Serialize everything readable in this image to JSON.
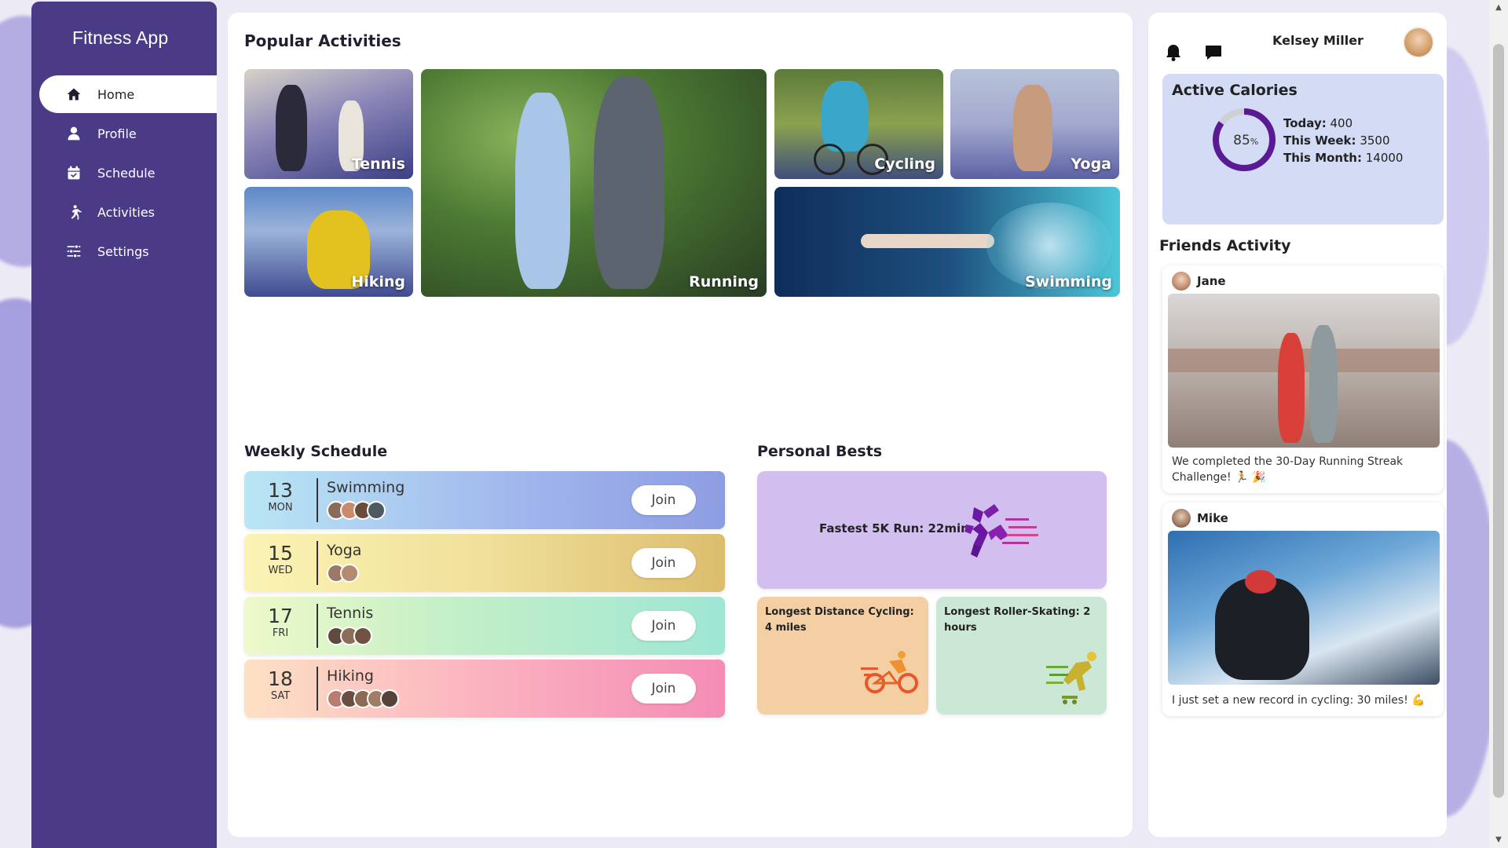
{
  "app": {
    "title": "Fitness App"
  },
  "sidebar": {
    "items": [
      {
        "label": "Home",
        "icon": "home-icon",
        "active": true
      },
      {
        "label": "Profile",
        "icon": "user-icon",
        "active": false
      },
      {
        "label": "Schedule",
        "icon": "calendar-icon",
        "active": false
      },
      {
        "label": "Activities",
        "icon": "running-icon",
        "active": false
      },
      {
        "label": "Settings",
        "icon": "sliders-icon",
        "active": false
      }
    ]
  },
  "popular": {
    "title": "Popular Activities",
    "tiles": [
      {
        "label": "Tennis"
      },
      {
        "label": "Running"
      },
      {
        "label": "Cycling"
      },
      {
        "label": "Yoga"
      },
      {
        "label": "Hiking"
      },
      {
        "label": "Swimming"
      }
    ]
  },
  "schedule": {
    "title": "Weekly Schedule",
    "rows": [
      {
        "day": "13",
        "weekday": "MON",
        "activity": "Swimming",
        "join": "Join",
        "participants": 4
      },
      {
        "day": "15",
        "weekday": "WED",
        "activity": "Yoga",
        "join": "Join",
        "participants": 2
      },
      {
        "day": "17",
        "weekday": "FRI",
        "activity": "Tennis",
        "join": "Join",
        "participants": 3
      },
      {
        "day": "18",
        "weekday": "SAT",
        "activity": "Hiking",
        "join": "Join",
        "participants": 5
      }
    ]
  },
  "bests": {
    "title": "Personal Bests",
    "main": "Fastest 5K Run: 22min",
    "cycling": "Longest Distance Cycling: 4 miles",
    "skating": "Longest Roller-Skating: 2 hours"
  },
  "header": {
    "user_name": "Kelsey Miller",
    "icons": [
      "bell-icon",
      "chat-icon"
    ]
  },
  "calories": {
    "title": "Active Calories",
    "percent": "85",
    "percent_unit": "%",
    "percent_value": 0.85,
    "today_label": "Today:",
    "today_value": "400",
    "week_label": "This Week:",
    "week_value": "3500",
    "month_label": "This Month:",
    "month_value": "14000",
    "ring_color": "#5a1a94"
  },
  "friends": {
    "title": "Friends Activity",
    "posts": [
      {
        "name": "Jane",
        "text": "We completed the 30-Day Running Streak Challenge! 🏃 🎉"
      },
      {
        "name": "Mike",
        "text": "I just set a new record in cycling: 30 miles! 💪"
      }
    ]
  }
}
